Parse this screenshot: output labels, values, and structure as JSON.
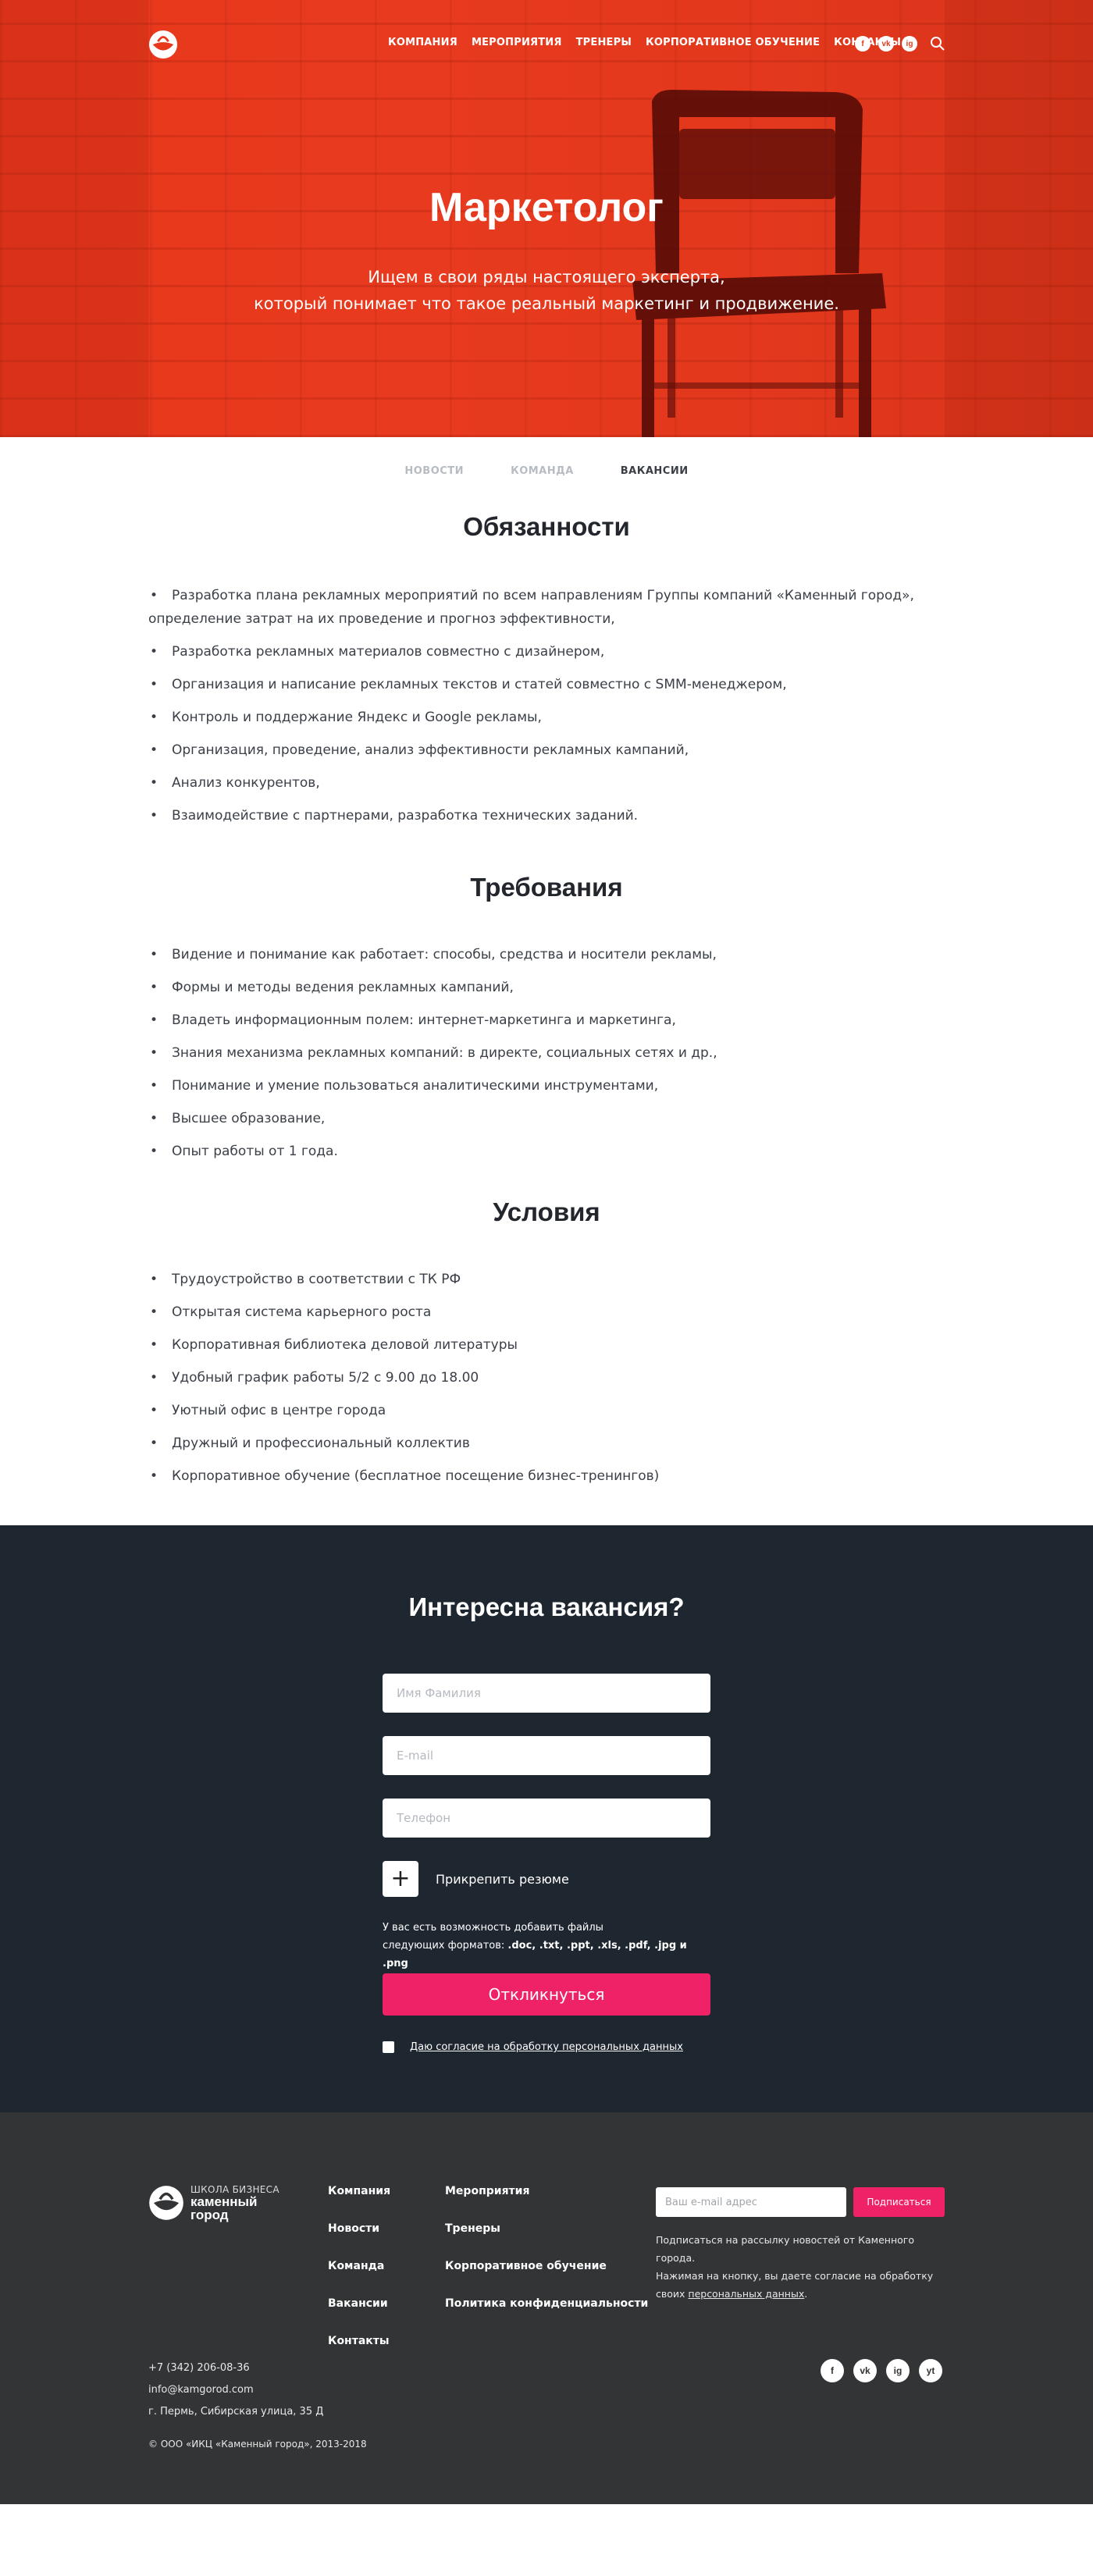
{
  "nav": {
    "items": [
      "КОМПАНИЯ",
      "МЕРОПРИЯТИЯ",
      "ТРЕНЕРЫ",
      "КОРПОРАТИВНОЕ ОБУЧЕНИЕ",
      "КОНТАКТЫ"
    ],
    "social": [
      "f",
      "vk",
      "ig"
    ]
  },
  "hero": {
    "title": "Маркетолог",
    "subtitle_line1": "Ищем в свои ряды настоящего эксперта,",
    "subtitle_line2": "который понимает что такое реальный маркетинг и продвижение."
  },
  "tabs": [
    "НОВОСТИ",
    "КОМАНДА",
    "ВАКАНСИИ"
  ],
  "active_tab": "ВАКАНСИИ",
  "bullet": "•",
  "duties": {
    "title": "Обязанности",
    "items": [
      "Разработка плана рекламных мероприятий по всем направлениям Группы компаний «Каменный город», определение затрат на их проведение и прогноз эффективности,",
      "Разработка рекламных материалов совместно с дизайнером,",
      "Организация и написание рекламных текстов и статей совместно с SMM-менеджером,",
      "Контроль и поддержание Яндекс и Google рекламы,",
      "Организация, проведение, анализ эффективности рекламных кампаний,",
      "Анализ конкурентов,",
      "Взаимодействие с партнерами, разработка технических заданий."
    ]
  },
  "requirements": {
    "title": "Требования",
    "items": [
      "Видение и понимание как работает: способы, средства и носители рекламы,",
      "Формы и методы ведения рекламных кампаний,",
      "Владеть информационным полем: интернет-маркетинга и маркетинга,",
      "Знания механизма рекламных компаний: в директе, социальных сетях и др.,",
      "Понимание и умение пользоваться аналитическими инструментами,",
      "Высшее образование,",
      "Опыт работы от 1 года."
    ]
  },
  "conditions": {
    "title": "Условия",
    "items": [
      "Трудоустройство в соответствии с ТК РФ",
      "Открытая система карьерного роста",
      "Корпоративная библиотека деловой литературы",
      "Удобный график работы 5/2 с 9.00 до 18.00",
      "Уютный офис в центре города",
      "Дружный и профессиональный коллектив",
      "Корпоративное обучение (бесплатное посещение бизнес-тренингов)"
    ]
  },
  "form": {
    "title": "Интересна вакансия?",
    "name_placeholder": "Имя Фамилия",
    "email_placeholder": "E-mail",
    "phone_placeholder": "Телефон",
    "attach_label": "Прикрепить резюме",
    "note_line1": "У вас есть возможность добавить файлы",
    "note_line2_prefix": "следующих форматов: ",
    "note_formats": ".doc, .txt, .ppt, .xls, .pdf, .jpg и .png",
    "submit_label": "Откликнуться",
    "consent_label": "Даю согласие на обработку персональных данных"
  },
  "footer": {
    "logo_line1": "ШКОЛА БИЗНЕСА",
    "logo_line2": "каменный",
    "logo_line3": "город",
    "col1": [
      "Компания",
      "Новости",
      "Команда",
      "Вакансии",
      "Контакты"
    ],
    "col2": [
      "Мероприятия",
      "Тренеры",
      "Корпоративное обучение",
      "Политика конфиденциальности"
    ],
    "subscribe_placeholder": "Ваш e-mail адрес",
    "subscribe_button": "Подписаться",
    "subscribe_note_1": "Подписаться на рассылку новостей от Каменного города.",
    "subscribe_note_2": "Нажимая на кнопку, вы даете согласие на обработку",
    "subscribe_note_3_prefix": "своих ",
    "subscribe_note_3_link": "персональных данных",
    "subscribe_note_3_suffix": ".",
    "phone": "+7 (342) 206-08-36",
    "email": "info@kamgorod.com",
    "address": "г. Пермь, Сибирская улица, 35 Д",
    "copyright": "© ООО «ИКЦ «Каменный город», 2013-2018",
    "social": [
      "f",
      "vk",
      "ig",
      "yt"
    ]
  },
  "colors": {
    "hero_red": "#e8381c",
    "form_bg": "#1e2630",
    "footer_bg": "#333436",
    "accent_pink": "#ef2267"
  }
}
